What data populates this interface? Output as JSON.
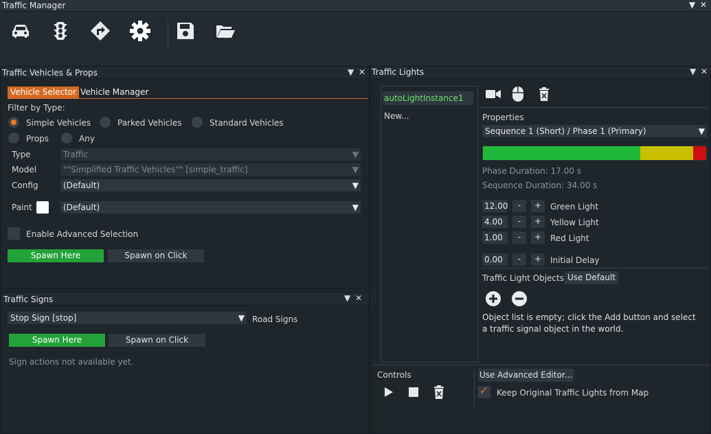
{
  "window": {
    "title": "Traffic Manager"
  },
  "toolbar": {
    "icons": [
      "car-icon",
      "traffic-light-icon",
      "direction-sign-icon",
      "gear-icon",
      "save-icon",
      "folder-open-icon"
    ]
  },
  "vehicles_panel": {
    "title": "Traffic Vehicles & Props",
    "tabs": [
      "Vehicle Selector",
      "Vehicle Manager"
    ],
    "filter_label": "Filter by Type:",
    "radios": [
      "Simple Vehicles",
      "Parked Vehicles",
      "Standard Vehicles",
      "Props",
      "Any"
    ],
    "selected_radio": "Simple Vehicles",
    "type_label": "Type",
    "type_value": "Traffic",
    "model_label": "Model",
    "model_value": "\"\"Simplified Traffic Vehicles\"\" [simple_traffic]",
    "config_label": "Config",
    "config_value": "(Default)",
    "paint_label": "Paint",
    "paint_value": "(Default)",
    "paint_color": "#ffffff",
    "advanced_label": "Enable Advanced Selection",
    "spawn_here": "Spawn Here",
    "spawn_on_click": "Spawn on Click"
  },
  "signs_panel": {
    "title": "Traffic Signs",
    "sign_value": "Stop Sign [stop]",
    "category": "Road Signs",
    "spawn_here": "Spawn Here",
    "spawn_on_click": "Spawn on Click",
    "note": "Sign actions not available yet."
  },
  "lights_panel": {
    "title": "Traffic Lights",
    "instances": [
      "autoLightInstance1",
      "New..."
    ],
    "properties_label": "Properties",
    "sequence_value": "Sequence 1 (Short) / Phase 1 (Primary)",
    "phase_bar": {
      "green": 12.0,
      "yellow": 4.0,
      "red": 1.0
    },
    "colors": {
      "green": "#1fb83a",
      "yellow": "#c9c000",
      "red": "#cc0f0f",
      "accent": "#f07a1e"
    },
    "phase_duration": "Phase Duration: 17.00 s",
    "sequence_duration": "Sequence Duration: 34.00 s",
    "rows": [
      {
        "value": "12.00",
        "label": "Green Light"
      },
      {
        "value": "4.00",
        "label": "Yellow Light"
      },
      {
        "value": "1.00",
        "label": "Red Light"
      },
      {
        "value": "0.00",
        "label": "Initial Delay"
      }
    ],
    "minus": "-",
    "plus": "+",
    "objects_label": "Traffic Light Objects",
    "use_default": "Use Default",
    "empty_msg": "Object list is empty; click the Add button and select a traffic signal object in the world.",
    "controls_label": "Controls",
    "advanced_editor": "Use Advanced Editor...",
    "keep_original": "Keep Original Traffic Lights from Map"
  }
}
